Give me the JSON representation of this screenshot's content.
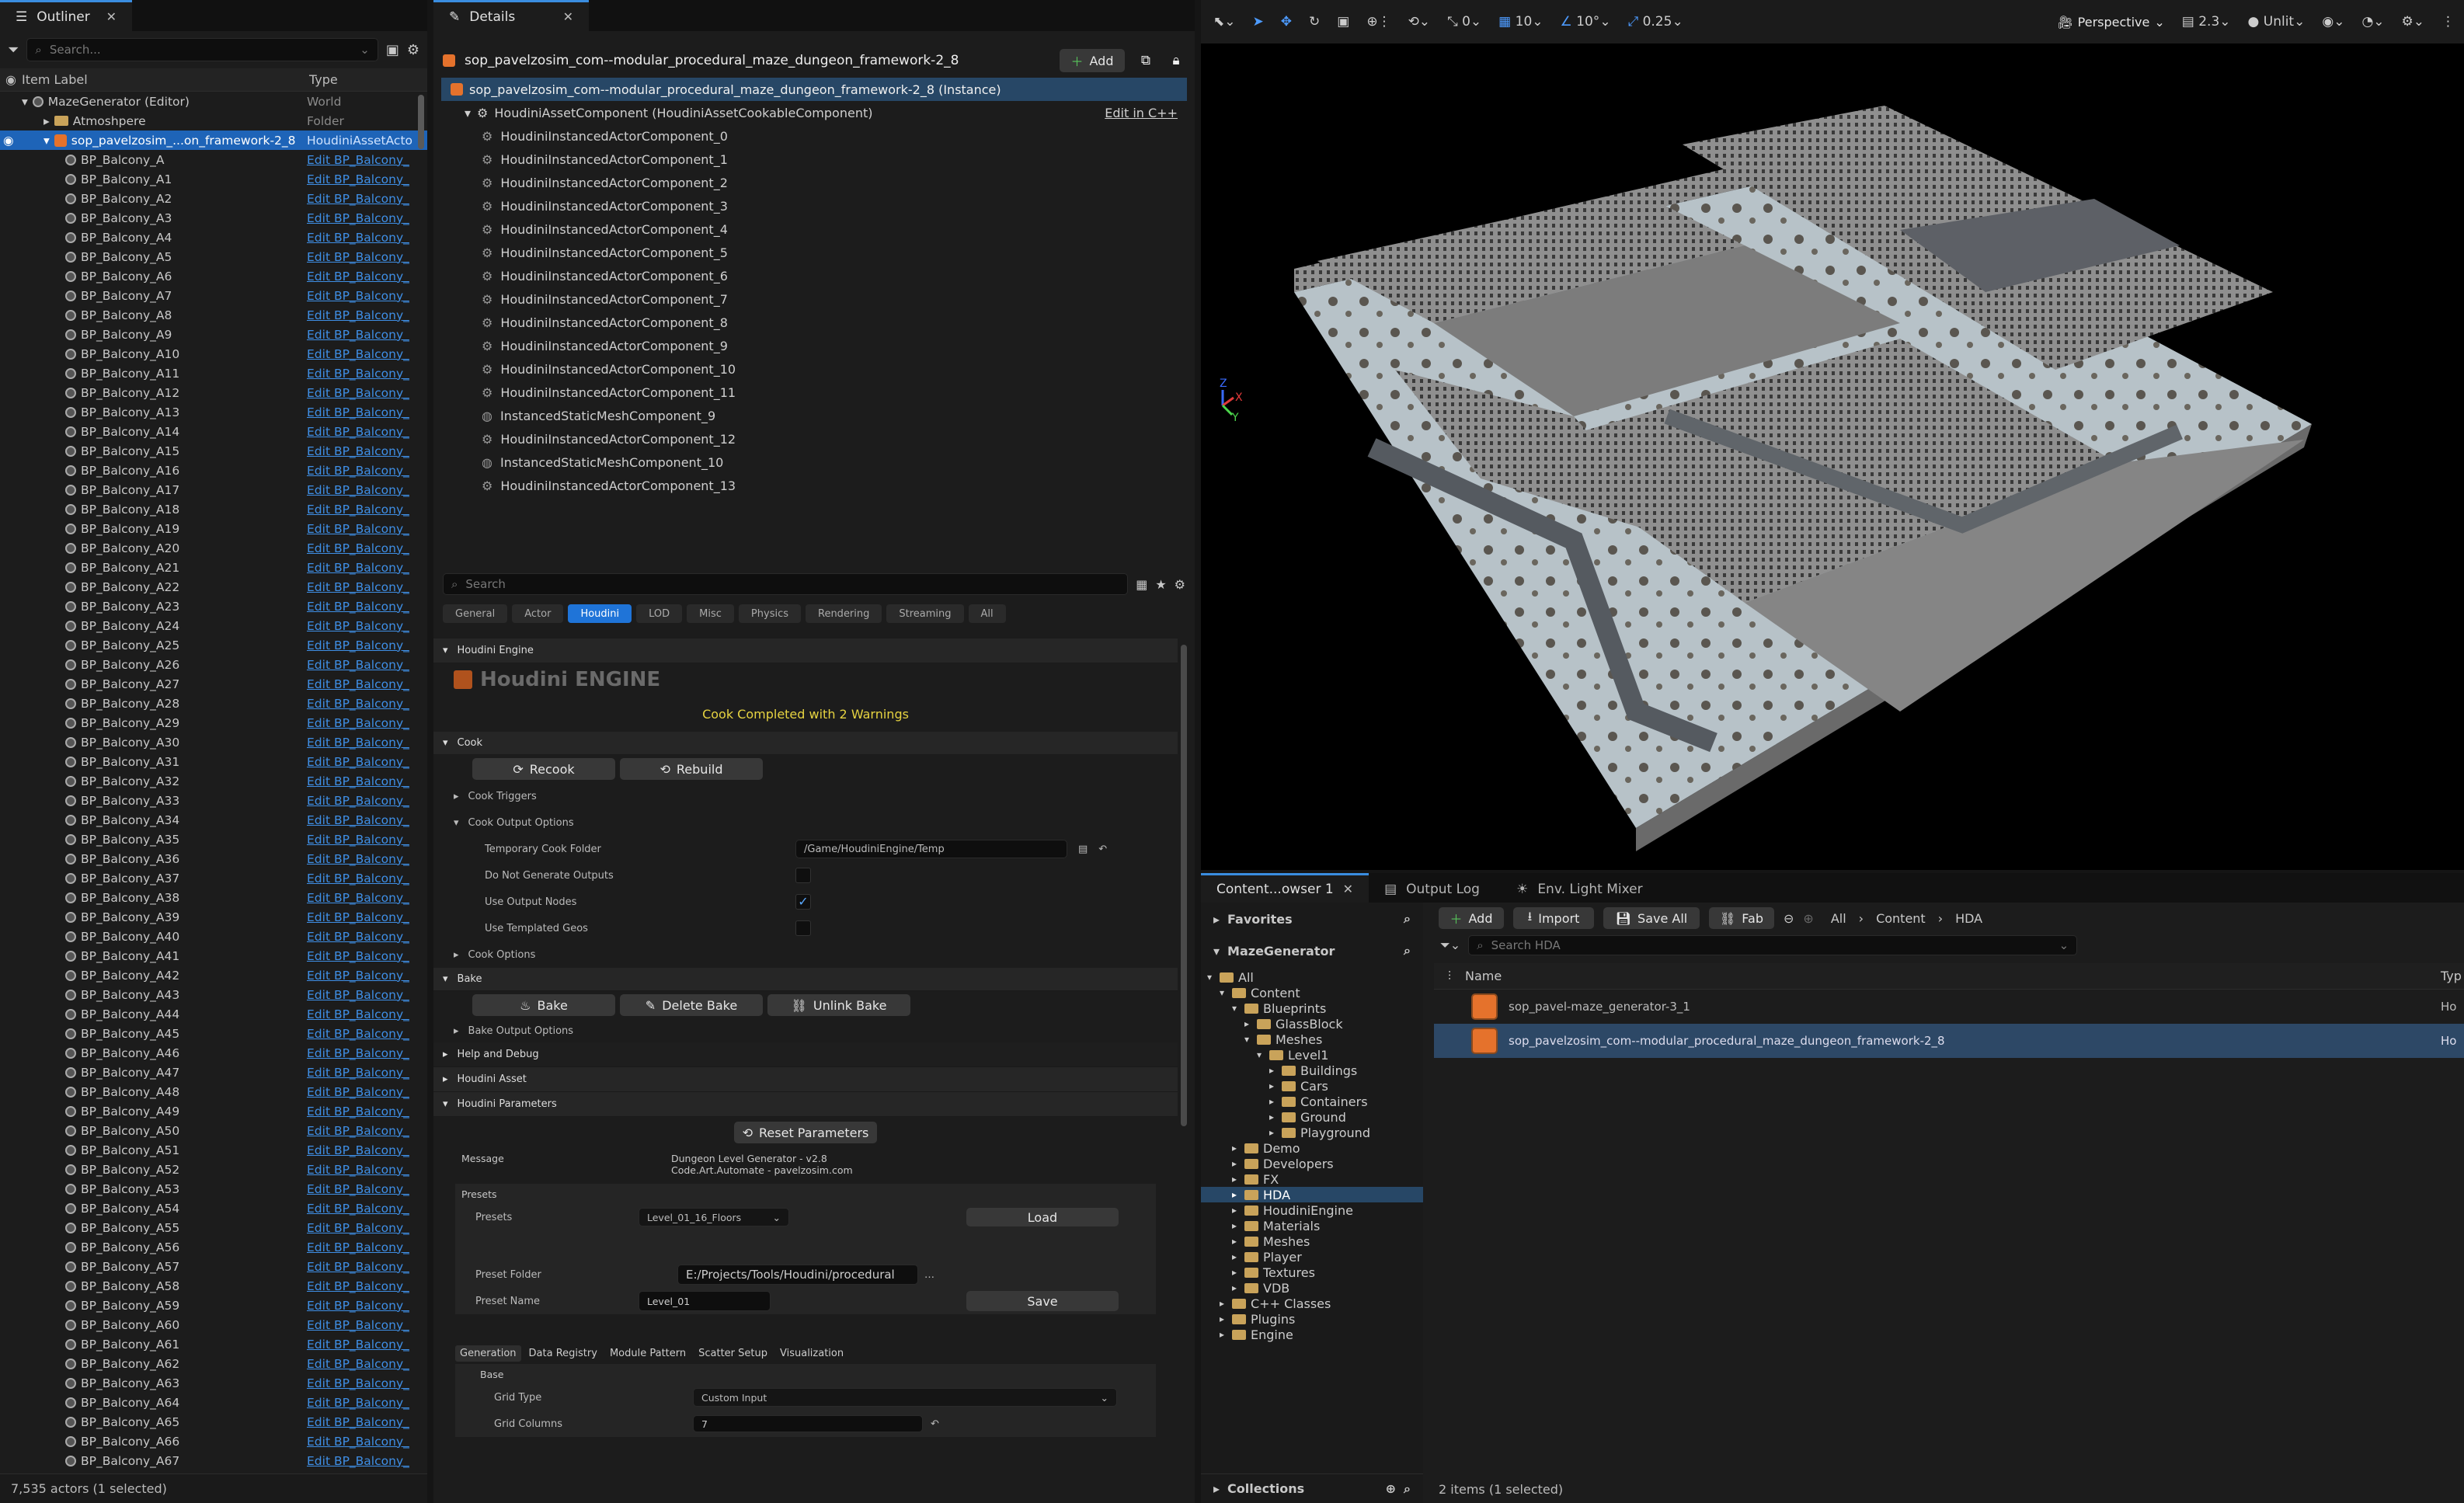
{
  "outliner": {
    "tab_label": "Outliner",
    "search_placeholder": "Search...",
    "col_label": "Item Label",
    "col_type": "Type",
    "rows": [
      {
        "label": "MazeGenerator (Editor)",
        "type": "World",
        "indent": 1,
        "kind": "world",
        "type_link": false
      },
      {
        "label": "Atmoshpere",
        "type": "Folder",
        "indent": 2,
        "kind": "folder",
        "type_link": false
      },
      {
        "label": "sop_pavelzosim_...on_framework-2_8",
        "type": "HoudiniAssetActo",
        "indent": 2,
        "kind": "hda",
        "type_link": false,
        "selected": true
      },
      {
        "label": "BP_Balcony_A",
        "type": "Edit BP_Balcony_",
        "indent": 3
      },
      {
        "label": "BP_Balcony_A1",
        "type": "Edit BP_Balcony_",
        "indent": 3
      },
      {
        "label": "BP_Balcony_A2",
        "type": "Edit BP_Balcony_",
        "indent": 3
      },
      {
        "label": "BP_Balcony_A3",
        "type": "Edit BP_Balcony_",
        "indent": 3
      },
      {
        "label": "BP_Balcony_A4",
        "type": "Edit BP_Balcony_",
        "indent": 3
      },
      {
        "label": "BP_Balcony_A5",
        "type": "Edit BP_Balcony_",
        "indent": 3
      },
      {
        "label": "BP_Balcony_A6",
        "type": "Edit BP_Balcony_",
        "indent": 3
      },
      {
        "label": "BP_Balcony_A7",
        "type": "Edit BP_Balcony_",
        "indent": 3
      },
      {
        "label": "BP_Balcony_A8",
        "type": "Edit BP_Balcony_",
        "indent": 3
      },
      {
        "label": "BP_Balcony_A9",
        "type": "Edit BP_Balcony_",
        "indent": 3
      },
      {
        "label": "BP_Balcony_A10",
        "type": "Edit BP_Balcony_",
        "indent": 3
      },
      {
        "label": "BP_Balcony_A11",
        "type": "Edit BP_Balcony_",
        "indent": 3
      },
      {
        "label": "BP_Balcony_A12",
        "type": "Edit BP_Balcony_",
        "indent": 3
      },
      {
        "label": "BP_Balcony_A13",
        "type": "Edit BP_Balcony_",
        "indent": 3
      },
      {
        "label": "BP_Balcony_A14",
        "type": "Edit BP_Balcony_",
        "indent": 3
      },
      {
        "label": "BP_Balcony_A15",
        "type": "Edit BP_Balcony_",
        "indent": 3
      },
      {
        "label": "BP_Balcony_A16",
        "type": "Edit BP_Balcony_",
        "indent": 3
      },
      {
        "label": "BP_Balcony_A17",
        "type": "Edit BP_Balcony_",
        "indent": 3
      },
      {
        "label": "BP_Balcony_A18",
        "type": "Edit BP_Balcony_",
        "indent": 3
      },
      {
        "label": "BP_Balcony_A19",
        "type": "Edit BP_Balcony_",
        "indent": 3
      },
      {
        "label": "BP_Balcony_A20",
        "type": "Edit BP_Balcony_",
        "indent": 3
      },
      {
        "label": "BP_Balcony_A21",
        "type": "Edit BP_Balcony_",
        "indent": 3
      },
      {
        "label": "BP_Balcony_A22",
        "type": "Edit BP_Balcony_",
        "indent": 3
      },
      {
        "label": "BP_Balcony_A23",
        "type": "Edit BP_Balcony_",
        "indent": 3
      },
      {
        "label": "BP_Balcony_A24",
        "type": "Edit BP_Balcony_",
        "indent": 3
      },
      {
        "label": "BP_Balcony_A25",
        "type": "Edit BP_Balcony_",
        "indent": 3
      },
      {
        "label": "BP_Balcony_A26",
        "type": "Edit BP_Balcony_",
        "indent": 3
      },
      {
        "label": "BP_Balcony_A27",
        "type": "Edit BP_Balcony_",
        "indent": 3
      },
      {
        "label": "BP_Balcony_A28",
        "type": "Edit BP_Balcony_",
        "indent": 3
      },
      {
        "label": "BP_Balcony_A29",
        "type": "Edit BP_Balcony_",
        "indent": 3
      },
      {
        "label": "BP_Balcony_A30",
        "type": "Edit BP_Balcony_",
        "indent": 3
      },
      {
        "label": "BP_Balcony_A31",
        "type": "Edit BP_Balcony_",
        "indent": 3
      },
      {
        "label": "BP_Balcony_A32",
        "type": "Edit BP_Balcony_",
        "indent": 3
      },
      {
        "label": "BP_Balcony_A33",
        "type": "Edit BP_Balcony_",
        "indent": 3
      },
      {
        "label": "BP_Balcony_A34",
        "type": "Edit BP_Balcony_",
        "indent": 3
      },
      {
        "label": "BP_Balcony_A35",
        "type": "Edit BP_Balcony_",
        "indent": 3
      },
      {
        "label": "BP_Balcony_A36",
        "type": "Edit BP_Balcony_",
        "indent": 3
      },
      {
        "label": "BP_Balcony_A37",
        "type": "Edit BP_Balcony_",
        "indent": 3
      },
      {
        "label": "BP_Balcony_A38",
        "type": "Edit BP_Balcony_",
        "indent": 3
      },
      {
        "label": "BP_Balcony_A39",
        "type": "Edit BP_Balcony_",
        "indent": 3
      },
      {
        "label": "BP_Balcony_A40",
        "type": "Edit BP_Balcony_",
        "indent": 3
      },
      {
        "label": "BP_Balcony_A41",
        "type": "Edit BP_Balcony_",
        "indent": 3
      },
      {
        "label": "BP_Balcony_A42",
        "type": "Edit BP_Balcony_",
        "indent": 3
      },
      {
        "label": "BP_Balcony_A43",
        "type": "Edit BP_Balcony_",
        "indent": 3
      },
      {
        "label": "BP_Balcony_A44",
        "type": "Edit BP_Balcony_",
        "indent": 3
      },
      {
        "label": "BP_Balcony_A45",
        "type": "Edit BP_Balcony_",
        "indent": 3
      },
      {
        "label": "BP_Balcony_A46",
        "type": "Edit BP_Balcony_",
        "indent": 3
      },
      {
        "label": "BP_Balcony_A47",
        "type": "Edit BP_Balcony_",
        "indent": 3
      },
      {
        "label": "BP_Balcony_A48",
        "type": "Edit BP_Balcony_",
        "indent": 3
      },
      {
        "label": "BP_Balcony_A49",
        "type": "Edit BP_Balcony_",
        "indent": 3
      },
      {
        "label": "BP_Balcony_A50",
        "type": "Edit BP_Balcony_",
        "indent": 3
      },
      {
        "label": "BP_Balcony_A51",
        "type": "Edit BP_Balcony_",
        "indent": 3
      },
      {
        "label": "BP_Balcony_A52",
        "type": "Edit BP_Balcony_",
        "indent": 3
      },
      {
        "label": "BP_Balcony_A53",
        "type": "Edit BP_Balcony_",
        "indent": 3
      },
      {
        "label": "BP_Balcony_A54",
        "type": "Edit BP_Balcony_",
        "indent": 3
      },
      {
        "label": "BP_Balcony_A55",
        "type": "Edit BP_Balcony_",
        "indent": 3
      },
      {
        "label": "BP_Balcony_A56",
        "type": "Edit BP_Balcony_",
        "indent": 3
      },
      {
        "label": "BP_Balcony_A57",
        "type": "Edit BP_Balcony_",
        "indent": 3
      },
      {
        "label": "BP_Balcony_A58",
        "type": "Edit BP_Balcony_",
        "indent": 3
      },
      {
        "label": "BP_Balcony_A59",
        "type": "Edit BP_Balcony_",
        "indent": 3
      },
      {
        "label": "BP_Balcony_A60",
        "type": "Edit BP_Balcony_",
        "indent": 3
      },
      {
        "label": "BP_Balcony_A61",
        "type": "Edit BP_Balcony_",
        "indent": 3
      },
      {
        "label": "BP_Balcony_A62",
        "type": "Edit BP_Balcony_",
        "indent": 3
      },
      {
        "label": "BP_Balcony_A63",
        "type": "Edit BP_Balcony_",
        "indent": 3
      },
      {
        "label": "BP_Balcony_A64",
        "type": "Edit BP_Balcony_",
        "indent": 3
      },
      {
        "label": "BP_Balcony_A65",
        "type": "Edit BP_Balcony_",
        "indent": 3
      },
      {
        "label": "BP_Balcony_A66",
        "type": "Edit BP_Balcony_",
        "indent": 3
      },
      {
        "label": "BP_Balcony_A67",
        "type": "Edit BP_Balcony_",
        "indent": 3
      }
    ],
    "status": "7,535 actors (1 selected)"
  },
  "details": {
    "tab_label": "Details",
    "actor_name": "sop_pavelzosim_com--modular_procedural_maze_dungeon_framework-2_8",
    "add_label": "Add",
    "instance_label": "sop_pavelzosim_com--modular_procedural_maze_dungeon_framework-2_8 (Instance)",
    "houdini_component": "HoudiniAssetComponent (HoudiniAssetCookableComponent)",
    "edit_cpp": "Edit in C++",
    "components": [
      "HoudiniInstancedActorComponent_0",
      "HoudiniInstancedActorComponent_1",
      "HoudiniInstancedActorComponent_2",
      "HoudiniInstancedActorComponent_3",
      "HoudiniInstancedActorComponent_4",
      "HoudiniInstancedActorComponent_5",
      "HoudiniInstancedActorComponent_6",
      "HoudiniInstancedActorComponent_7",
      "HoudiniInstancedActorComponent_8",
      "HoudiniInstancedActorComponent_9",
      "HoudiniInstancedActorComponent_10",
      "HoudiniInstancedActorComponent_11",
      "InstancedStaticMeshComponent_9",
      "HoudiniInstancedActorComponent_12",
      "InstancedStaticMeshComponent_10",
      "HoudiniInstancedActorComponent_13"
    ],
    "search_placeholder": "Search",
    "filter_tabs": [
      "General",
      "Actor",
      "Houdini",
      "LOD",
      "Misc",
      "Physics",
      "Rendering",
      "Streaming",
      "All"
    ],
    "active_filter": "Houdini",
    "houdini_engine_section": "Houdini Engine",
    "logo_text": "Houdini ENGINE",
    "cook_status": "Cook Completed with 2 Warnings",
    "cook_section": "Cook",
    "recook": "Recook",
    "rebuild": "Rebuild",
    "cook_triggers": "Cook Triggers",
    "cook_output_options": "Cook Output Options",
    "temp_cook_folder_label": "Temporary Cook Folder",
    "temp_cook_folder_value": "/Game/HoudiniEngine/Temp",
    "do_not_generate": "Do Not Generate Outputs",
    "use_output_nodes": "Use Output Nodes",
    "use_templated": "Use Templated Geos",
    "cook_options": "Cook Options",
    "bake_section": "Bake",
    "bake": "Bake",
    "delete_bake": "Delete Bake",
    "unlink_bake": "Unlink Bake",
    "bake_output_options": "Bake Output Options",
    "help_debug": "Help and Debug",
    "houdini_asset": "Houdini Asset",
    "houdini_params": "Houdini Parameters",
    "reset_params": "Reset Parameters",
    "message_label": "Message",
    "message_line1": "Dungeon Level Generator - v2.8",
    "message_line2": "Code.Art.Automate - pavelzosim.com",
    "presets_group": "Presets",
    "presets_label": "Presets",
    "presets_value": "Level_01_16_Floors",
    "load": "Load",
    "preset_folder_label": "Preset Folder",
    "preset_folder_value": "E:/Projects/Tools/Houdini/procedural",
    "preset_name_label": "Preset Name",
    "preset_name_value": "Level_01",
    "save": "Save",
    "param_tabs": [
      "Generation",
      "Data Registry",
      "Module Pattern",
      "Scatter Setup",
      "Visualization"
    ],
    "base_label": "Base",
    "grid_type_label": "Grid Type",
    "grid_type_value": "Custom Input",
    "grid_columns_label": "Grid Columns",
    "grid_columns_value": "7"
  },
  "viewport": {
    "rot_snap": "0",
    "grid_snap": "10",
    "angle_snap": "10°",
    "scale_snap": "0.25",
    "view_mode": "Perspective",
    "camera_speed": "2.3",
    "lit_mode": "Unlit"
  },
  "content": {
    "tab_label": "Content...owser 1",
    "output_log": "Output Log",
    "light_mixer": "Env. Light Mixer",
    "favorites": "Favorites",
    "project": "MazeGenerator",
    "add": "Add",
    "import": "Import",
    "save_all": "Save All",
    "fab": "Fab",
    "path": [
      "All",
      "Content",
      "HDA"
    ],
    "search_placeholder": "Search HDA",
    "col_name": "Name",
    "col_type": "Typ",
    "tree": [
      {
        "label": "All",
        "indent": 0,
        "open": true
      },
      {
        "label": "Content",
        "indent": 1,
        "open": true
      },
      {
        "label": "Blueprints",
        "indent": 2,
        "open": true
      },
      {
        "label": "GlassBlock",
        "indent": 3,
        "open": false
      },
      {
        "label": "Meshes",
        "indent": 3,
        "open": true
      },
      {
        "label": "Level1",
        "indent": 4,
        "open": true
      },
      {
        "label": "Buildings",
        "indent": 5,
        "open": false
      },
      {
        "label": "Cars",
        "indent": 5,
        "open": false
      },
      {
        "label": "Containers",
        "indent": 5,
        "open": false
      },
      {
        "label": "Ground",
        "indent": 5,
        "open": false
      },
      {
        "label": "Playground",
        "indent": 5,
        "open": false
      },
      {
        "label": "Demo",
        "indent": 2,
        "open": false
      },
      {
        "label": "Developers",
        "indent": 2,
        "open": false
      },
      {
        "label": "FX",
        "indent": 2,
        "open": false
      },
      {
        "label": "HDA",
        "indent": 2,
        "open": false,
        "selected": true
      },
      {
        "label": "HoudiniEngine",
        "indent": 2,
        "open": false
      },
      {
        "label": "Materials",
        "indent": 2,
        "open": false
      },
      {
        "label": "Meshes",
        "indent": 2,
        "open": false
      },
      {
        "label": "Player",
        "indent": 2,
        "open": false
      },
      {
        "label": "Textures",
        "indent": 2,
        "open": false
      },
      {
        "label": "VDB",
        "indent": 2,
        "open": false
      },
      {
        "label": "C++ Classes",
        "indent": 1,
        "open": false
      },
      {
        "label": "Plugins",
        "indent": 1,
        "open": false
      },
      {
        "label": "Engine",
        "indent": 1,
        "open": false
      }
    ],
    "items": [
      {
        "name": "sop_pavel-maze_generator-3_1",
        "type": "Ho"
      },
      {
        "name": "sop_pavelzosim_com--modular_procedural_maze_dungeon_framework-2_8",
        "type": "Ho",
        "selected": true
      }
    ],
    "collections": "Collections",
    "status": "2 items (1 selected)"
  }
}
